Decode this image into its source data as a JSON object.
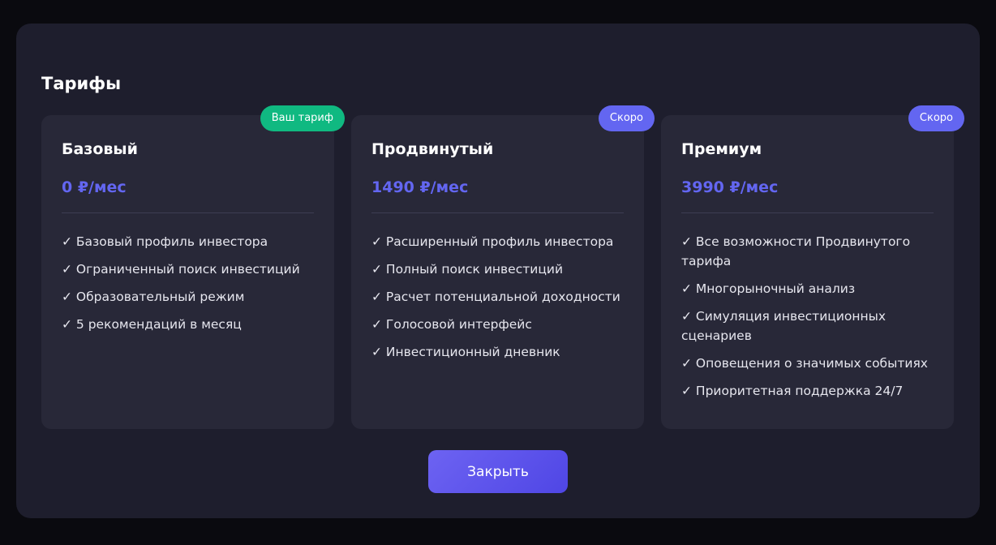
{
  "modal": {
    "title": "Тарифы",
    "close_label": "Закрыть"
  },
  "plans": [
    {
      "name": "Базовый",
      "price": "0 ₽/мес",
      "badge": "Ваш тариф",
      "badge_color": "#10b981",
      "features": [
        "✓ Базовый профиль инвестора",
        "✓ Ограниченный поиск инвестиций",
        "✓ Образовательный режим",
        "✓ 5 рекомендаций в месяц"
      ]
    },
    {
      "name": "Продвинутый",
      "price": "1490 ₽/мес",
      "badge": "Скоро",
      "badge_color": "#6366f1",
      "features": [
        "✓ Расширенный профиль инвестора",
        "✓ Полный поиск инвестиций",
        "✓ Расчет потенциальной доходности",
        "✓ Голосовой интерфейс",
        "✓ Инвестиционный дневник"
      ]
    },
    {
      "name": "Премиум",
      "price": "3990 ₽/мес",
      "badge": "Скоро",
      "badge_color": "#6366f1",
      "features": [
        "✓ Все возможности Продвинутого тарифа",
        "✓ Многорыночный анализ",
        "✓ Симуляция инвестиционных сценариев",
        "✓ Оповещения о значимых событиях",
        "✓ Приоритетная поддержка 24/7"
      ]
    }
  ],
  "colors": {
    "accent": "#6366f1",
    "current_plan_badge": "#10b981",
    "modal_background": "#1e1e2d",
    "card_background": "#282838"
  }
}
